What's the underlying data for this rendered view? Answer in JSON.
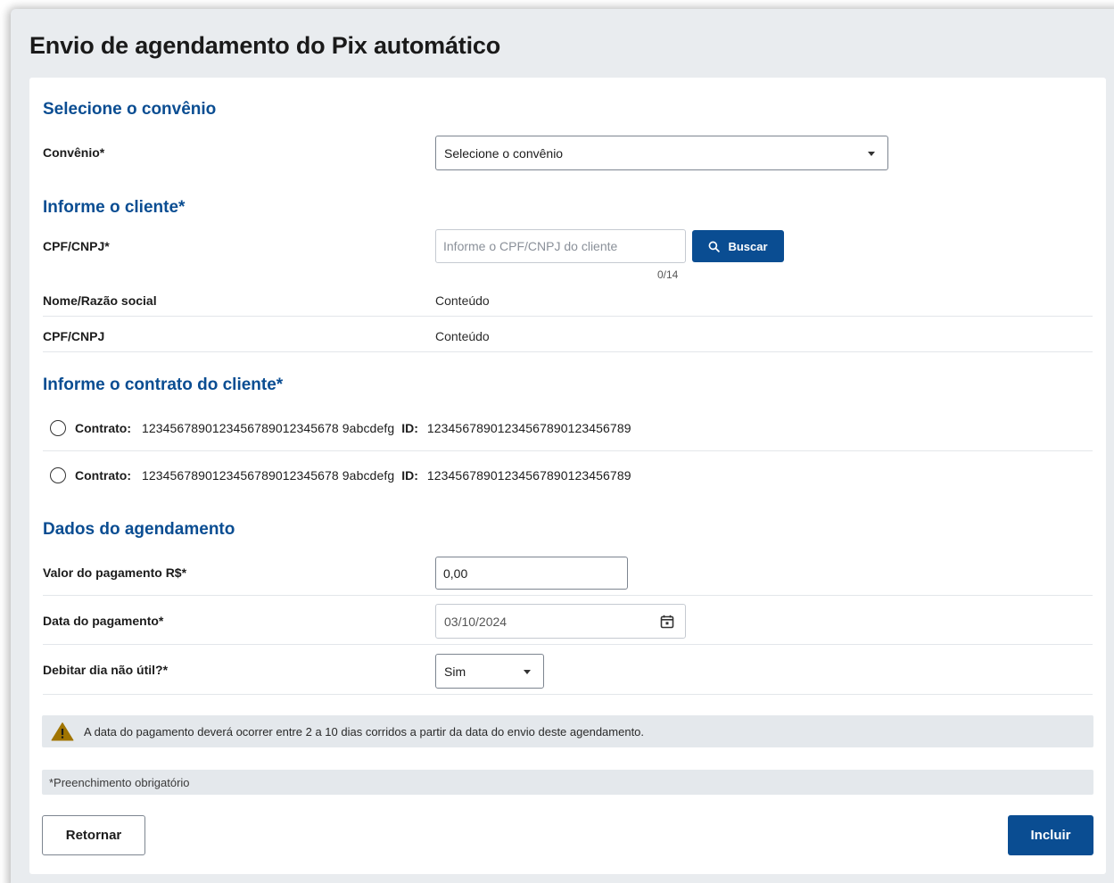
{
  "page": {
    "title": "Envio de agendamento do Pix automático"
  },
  "convenio_section": {
    "title": "Selecione o convênio",
    "label": "Convênio*",
    "selected": "Selecione o convênio"
  },
  "cliente_section": {
    "title": "Informe o cliente*",
    "cpf_label": "CPF/CNPJ*",
    "cpf_placeholder": "Informe o CPF/CNPJ do cliente",
    "cpf_value": "",
    "char_counter": "0/14",
    "search_label": "Buscar",
    "search_icon": "search-icon",
    "info_rows": [
      {
        "label": "Nome/Razão social",
        "value": "Conteúdo"
      },
      {
        "label": "CPF/CNPJ",
        "value": "Conteúdo"
      }
    ]
  },
  "contrato_section": {
    "title": "Informe o contrato do cliente*",
    "options": [
      {
        "contrato_key": "Contrato:",
        "contrato_value": "1234567890123456789012345678 9abcdefg",
        "id_key": "ID:",
        "id_value": "12345678901234567890123456789",
        "selected": false
      },
      {
        "contrato_key": "Contrato:",
        "contrato_value": "1234567890123456789012345678 9abcdefg",
        "id_key": "ID:",
        "id_value": "12345678901234567890123456789",
        "selected": false
      }
    ]
  },
  "agendamento_section": {
    "title": "Dados do agendamento",
    "valor_label": "Valor do pagamento R$*",
    "valor_value": "0,00",
    "data_label": "Data do pagamento*",
    "data_value": "03/10/2024",
    "data_icon": "calendar-icon",
    "debitar_label": "Debitar dia não útil?*",
    "debitar_selected": "Sim"
  },
  "alert": {
    "icon": "warning-icon",
    "text": "A data do pagamento deverá ocorrer entre 2 a 10 dias corridos a partir da data do envio deste agendamento."
  },
  "note": {
    "text": "*Preenchimento obrigatório"
  },
  "footer": {
    "back_label": "Retornar",
    "submit_label": "Incluir"
  },
  "colors": {
    "brand": "#0a4d92",
    "warning": "#a07400",
    "background": "#e9ecef"
  }
}
